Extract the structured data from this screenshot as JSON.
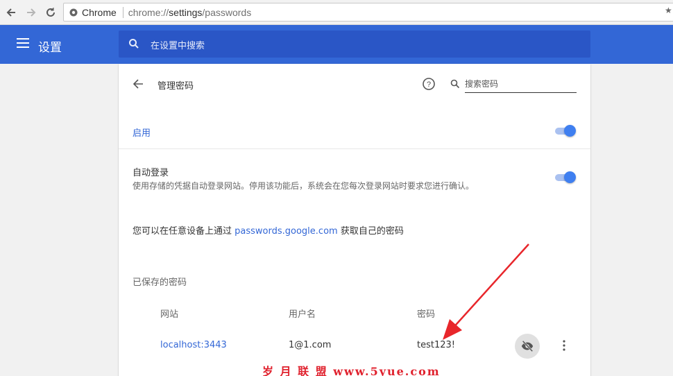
{
  "browser": {
    "app_name": "Chrome",
    "url_scheme": "chrome://",
    "url_host": "settings",
    "url_path": "/passwords"
  },
  "header": {
    "title": "设置",
    "search_placeholder": "在设置中搜索"
  },
  "passwords_page": {
    "title": "管理密码",
    "search_placeholder": "搜索密码",
    "enable_label": "启用",
    "enable_on": true,
    "autologin": {
      "title": "自动登录",
      "description": "使用存储的凭据自动登录网站。停用该功能后，系统会在您每次登录网站时要求您进行确认。",
      "on": true
    },
    "google_line": {
      "prefix": "您可以在任意设备上通过 ",
      "link": "passwords.google.com",
      "suffix": " 获取自己的密码"
    },
    "saved_heading": "已保存的密码",
    "columns": [
      "网站",
      "用户名",
      "密码"
    ],
    "rows": [
      {
        "site": "localhost:3443",
        "username": "1@1.com",
        "password": "test123!"
      }
    ]
  },
  "watermark": "岁 月 联 盟  www.5yue.com",
  "colors": {
    "header_blue": "#3367d6",
    "search_blue": "#2a56c6",
    "toggle_blue": "#3f7ff0",
    "arrow_red": "#e8262b"
  }
}
